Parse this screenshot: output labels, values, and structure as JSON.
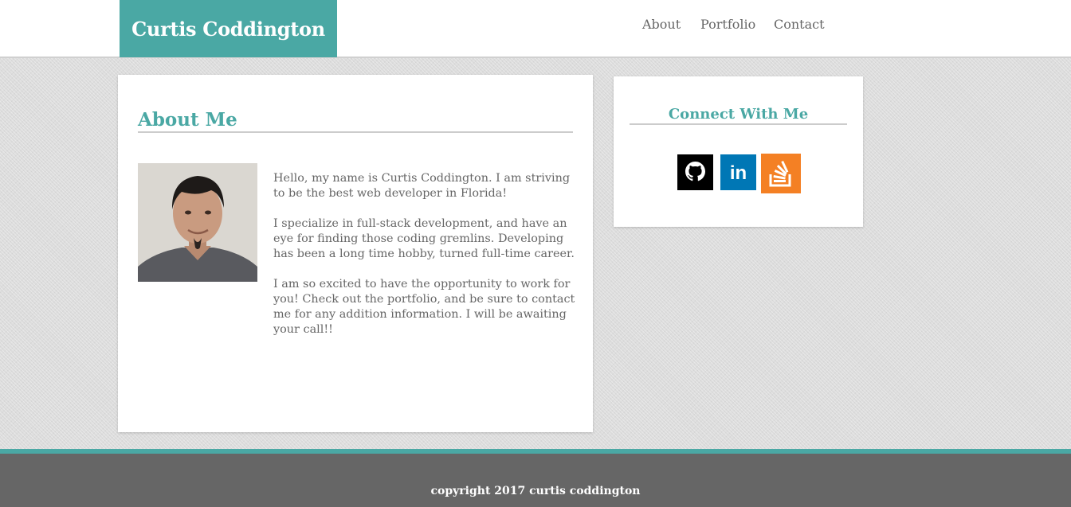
{
  "header": {
    "brand": "Curtis Coddington",
    "nav": [
      "About",
      "Portfolio",
      "Contact"
    ]
  },
  "about": {
    "title": "About Me",
    "paragraphs": [
      "Hello, my name is Curtis Coddington. I am striving to be the best web developer in Florida!",
      "I specialize in full-stack development, and have an eye for finding those coding gremlins. Developing has been a long time hobby, turned full-time career.",
      "I am so excited to have the opportunity to work for you! Check out the portfolio, and be sure to contact me for any addition information. I will be awaiting your call!!"
    ]
  },
  "connect": {
    "title": "Connect With Me",
    "links": [
      {
        "name": "github",
        "icon": "github-icon",
        "color": "#000000"
      },
      {
        "name": "linkedin",
        "icon": "linkedin-icon",
        "color": "#0077b5",
        "glyph": "in"
      },
      {
        "name": "stackoverflow",
        "icon": "stackoverflow-icon",
        "color": "#f48024"
      }
    ]
  },
  "footer": {
    "text": "copyright 2017 curtis coddington"
  },
  "colors": {
    "accent": "#4aa8a4",
    "text": "#666666",
    "footer": "#666666"
  }
}
